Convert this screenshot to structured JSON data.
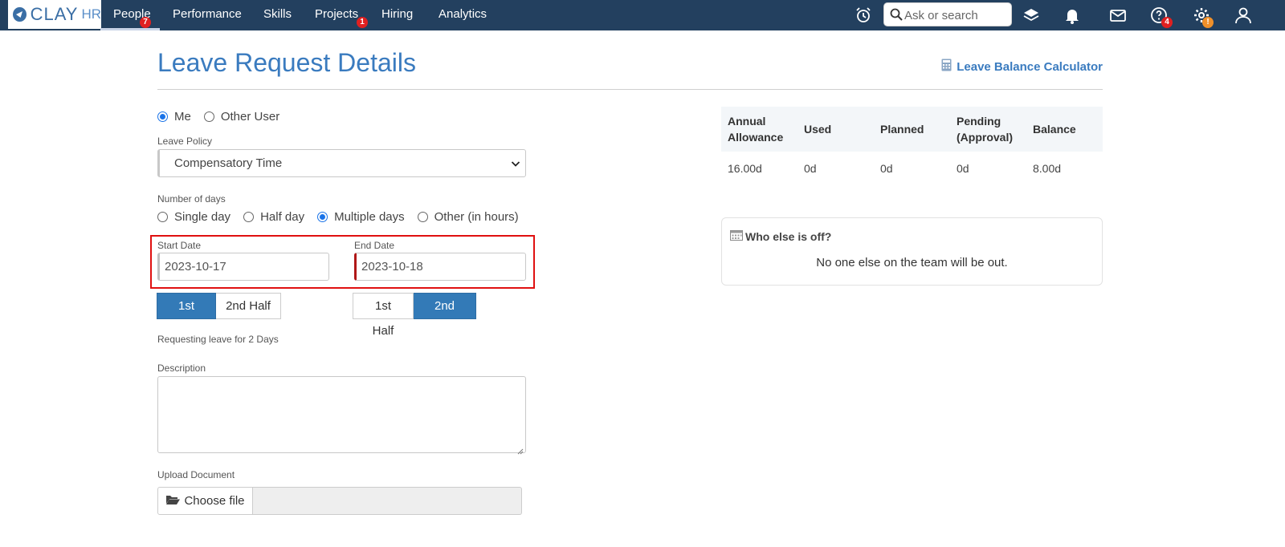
{
  "logo": {
    "brand": "CLAY",
    "suffix": "HR"
  },
  "nav": {
    "items": [
      {
        "label": "People",
        "badge": "7"
      },
      {
        "label": "Performance"
      },
      {
        "label": "Skills"
      },
      {
        "label": "Projects",
        "badge": "1"
      },
      {
        "label": "Hiring"
      },
      {
        "label": "Analytics"
      }
    ],
    "search_placeholder": "Ask or search",
    "help_badge": "4",
    "settings_badge": "!"
  },
  "page": {
    "title": "Leave Request Details",
    "calculator_link": "Leave Balance Calculator"
  },
  "form": {
    "user_options": [
      "Me",
      "Other User"
    ],
    "leave_policy_label": "Leave Policy",
    "leave_policy_value": "Compensatory Time",
    "days_label": "Number of days",
    "days_options": [
      "Single day",
      "Half day",
      "Multiple days",
      "Other (in hours)"
    ],
    "start_date_label": "Start Date",
    "start_date_value": "2023-10-17",
    "end_date_label": "End Date",
    "end_date_value": "2023-10-18",
    "first_half": "1st Half",
    "second_half": "2nd Half",
    "requesting_text": "Requesting leave for 2 Days",
    "description_label": "Description",
    "upload_label": "Upload Document",
    "choose_file": "Choose file"
  },
  "balance": {
    "headers": [
      "Annual Allowance",
      "Used",
      "Planned",
      "Pending (Approval)",
      "Balance"
    ],
    "values": [
      "16.00d",
      "0d",
      "0d",
      "0d",
      "8.00d"
    ]
  },
  "who_off": {
    "title": "Who else is off?",
    "message": "No one else on the team will be out."
  },
  "colors": {
    "navbar": "#23405f",
    "accent": "#337ab7",
    "highlight": "#e01010",
    "badge": "#e02020"
  }
}
